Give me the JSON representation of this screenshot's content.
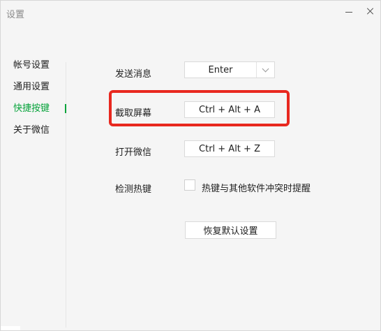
{
  "window": {
    "title": "设置"
  },
  "nav": {
    "items": [
      {
        "label": "帐号设置"
      },
      {
        "label": "通用设置"
      },
      {
        "label": "快捷按键"
      },
      {
        "label": "关于微信"
      }
    ],
    "active": "快捷按键"
  },
  "shortcuts": {
    "send": {
      "label": "发送消息",
      "value": "Enter"
    },
    "screenshot": {
      "label": "截取屏幕",
      "value": "Ctrl + Alt + A"
    },
    "open": {
      "label": "打开微信",
      "value": "Ctrl + Alt + Z"
    },
    "detect": {
      "label": "检测热键",
      "checkbox_label": "热键与其他软件冲突时提醒",
      "checked": false
    }
  },
  "reset_button": "恢复默认设置",
  "colors": {
    "accent_green": "#07a33b",
    "highlight_red": "#e8281f"
  }
}
